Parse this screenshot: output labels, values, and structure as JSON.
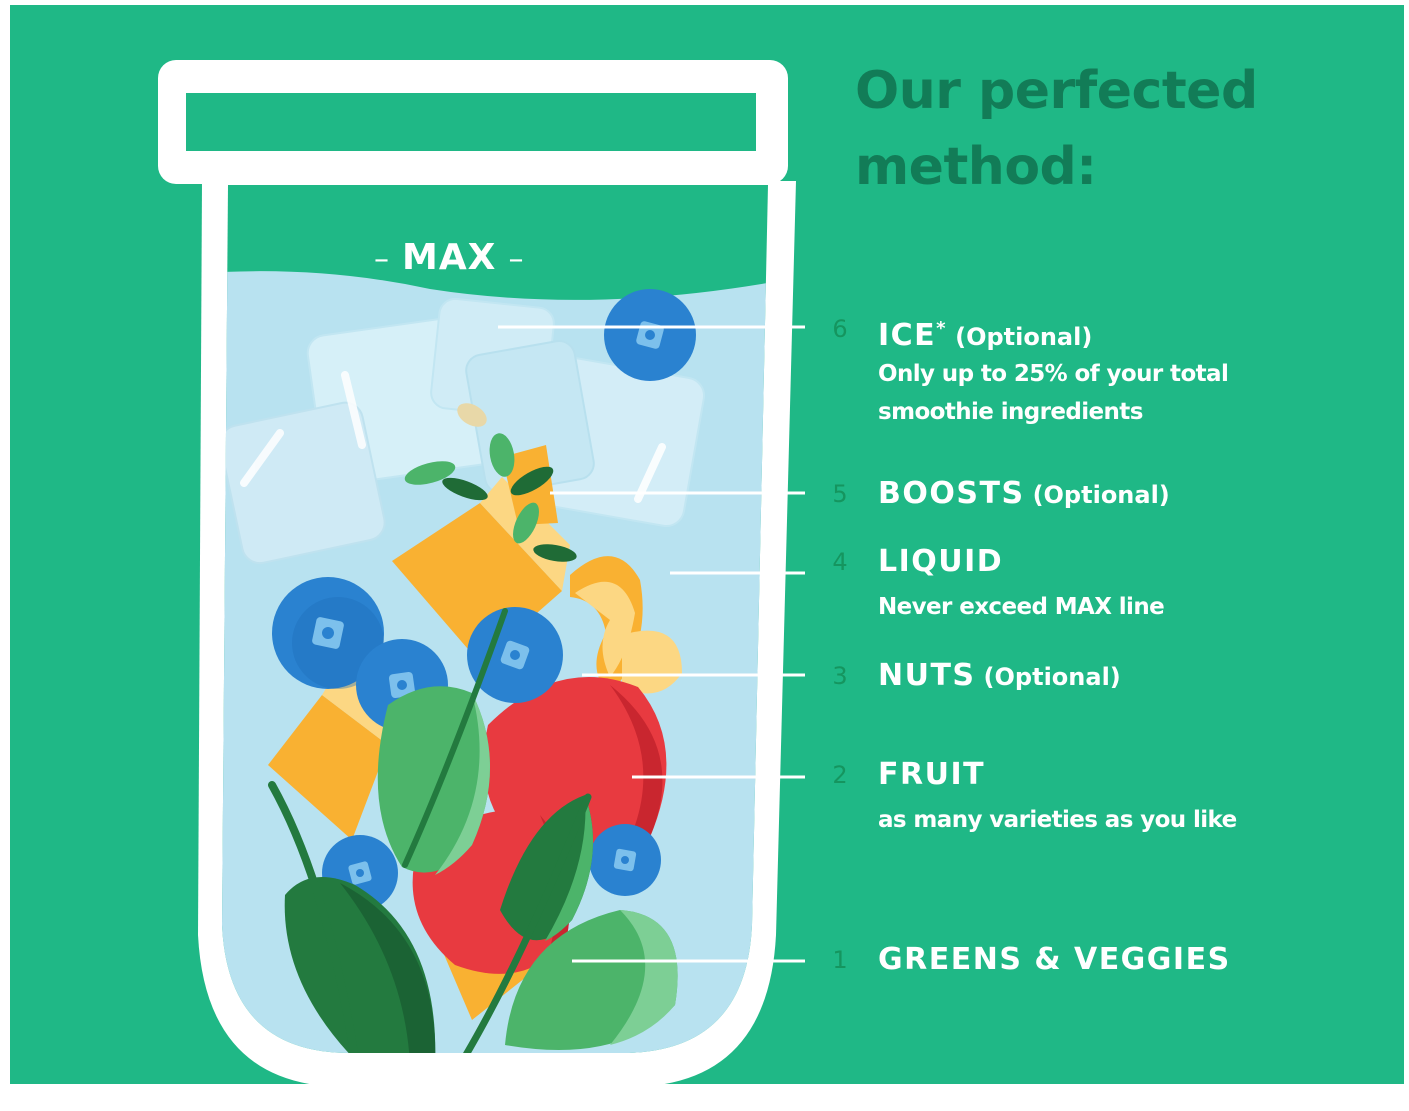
{
  "title": {
    "line1": "Our perfected",
    "line2": "method:"
  },
  "max_label": "MAX",
  "steps": [
    {
      "number": "6",
      "name": "ICE",
      "marker": "*",
      "note": "(Optional)",
      "description": "Only up to 25% of your total smoothie ingredients"
    },
    {
      "number": "5",
      "name": "BOOSTS",
      "marker": "",
      "note": "(Optional)",
      "description": ""
    },
    {
      "number": "4",
      "name": "LIQUID",
      "marker": "",
      "note": "",
      "description": "Never exceed MAX line"
    },
    {
      "number": "3",
      "name": "NUTS",
      "marker": "",
      "note": "(Optional)",
      "description": ""
    },
    {
      "number": "2",
      "name": "FRUIT",
      "marker": "",
      "note": "",
      "description": "as many varieties as you like"
    },
    {
      "number": "1",
      "name": "GREENS & VEGGIES",
      "marker": "",
      "note": "",
      "description": ""
    }
  ],
  "colors": {
    "background": "#1fb886",
    "title": "#127c57",
    "liquid": "#b8e2f0",
    "blueberry": "#2a82d0",
    "strawberry": "#e83a40",
    "mango": "#f9b132",
    "leaf_dark": "#237a3f",
    "leaf_light": "#4cb46a",
    "text": "#ffffff"
  }
}
